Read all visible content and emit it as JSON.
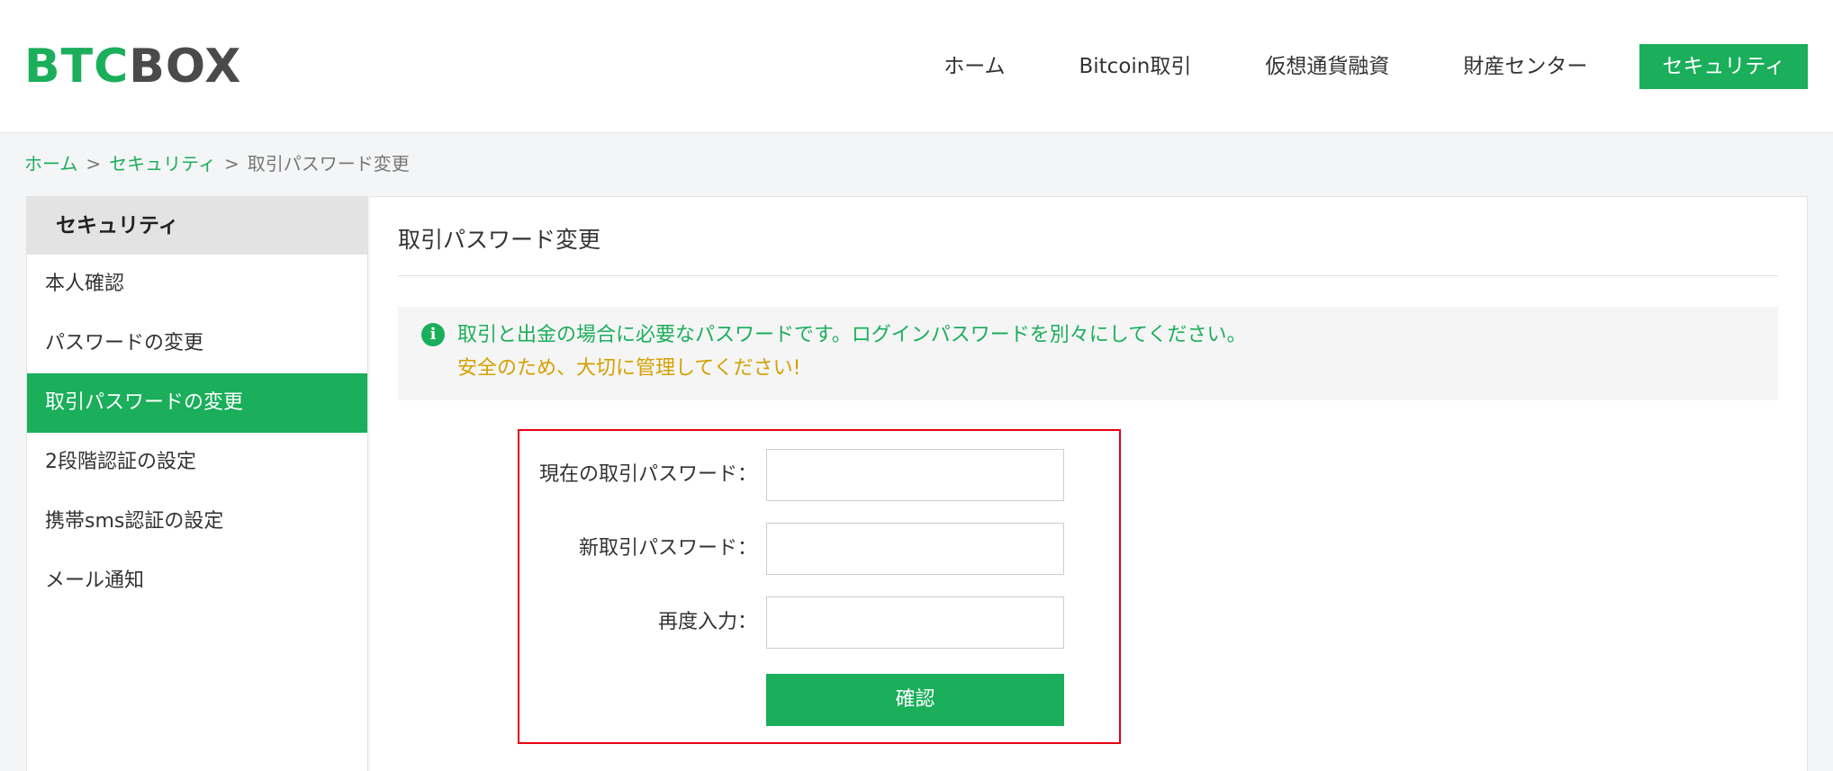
{
  "header": {
    "logo": {
      "part1": "BTC",
      "part2": "BOX"
    },
    "nav": [
      {
        "label": "ホーム",
        "active": false
      },
      {
        "label": "Bitcoin取引",
        "active": false
      },
      {
        "label": "仮想通貨融資",
        "active": false
      },
      {
        "label": "財産センター",
        "active": false
      },
      {
        "label": "セキュリティ",
        "active": true
      }
    ]
  },
  "breadcrumb": {
    "home": "ホーム",
    "separator": ">",
    "section": "セキュリティ",
    "current": "取引パスワード変更"
  },
  "sidebar": {
    "title": "セキュリティ",
    "items": [
      {
        "label": "本人確認",
        "active": false
      },
      {
        "label": "パスワードの変更",
        "active": false
      },
      {
        "label": "取引パスワードの変更",
        "active": true
      },
      {
        "label": "2段階認証の設定",
        "active": false
      },
      {
        "label": "携帯sms認証の設定",
        "active": false
      },
      {
        "label": "メール通知",
        "active": false
      }
    ]
  },
  "main": {
    "title": "取引パスワード変更",
    "notice": {
      "icon": "info-icon",
      "line1": "取引と出金の場合に必要なパスワードです。ログインパスワードを別々にしてください。",
      "line2": "安全のため、大切に管理してください!"
    },
    "form": {
      "current_password_label": "現在の取引パスワード：",
      "current_password_value": "",
      "new_password_label": "新取引パスワード：",
      "new_password_value": "",
      "confirm_password_label": "再度入力：",
      "confirm_password_value": "",
      "submit_label": "確認"
    }
  },
  "colors": {
    "brand_green": "#1bae5b",
    "logo_gray": "#4a4a4a",
    "warning": "#d4a000",
    "highlight_border": "#e60012"
  }
}
